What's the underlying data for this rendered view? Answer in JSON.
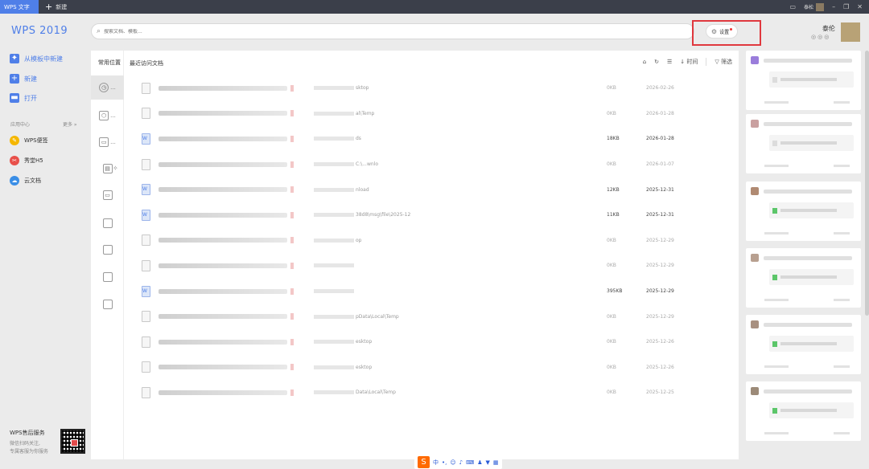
{
  "titlebar": {
    "active_tab": "WPS 文字",
    "new_tab": "新建",
    "user_short": "泰松"
  },
  "sidebar": {
    "logo": "WPS 2019",
    "nav": [
      {
        "label": "从模板中新建",
        "icon": "template-icon"
      },
      {
        "label": "新建",
        "icon": "plus-icon"
      },
      {
        "label": "打开",
        "icon": "folder-open-icon"
      }
    ],
    "apps_label": "应用中心",
    "more": "更多 »",
    "apps": [
      {
        "label": "WPS便签",
        "color": "#f5b700"
      },
      {
        "label": "秀堂H5",
        "color": "#e8504a"
      },
      {
        "label": "云文档",
        "color": "#3a8ee6"
      }
    ],
    "service": {
      "title": "WPS售后服务",
      "line1": "微信扫码关注,",
      "line2": "专属客服为你服务"
    }
  },
  "search": {
    "placeholder": "搜索文档、模板..."
  },
  "settings": {
    "label": "设置"
  },
  "user": {
    "name": "泰伦"
  },
  "places": {
    "title": "常用位置",
    "items": [
      "...",
      "...",
      "..."
    ]
  },
  "main": {
    "title": "最近访问文档",
    "toolbar": {
      "sort": "时间",
      "filter": "筛选"
    },
    "rows": [
      {
        "name": "...ers",
        "path": "sktop",
        "size": "0KB",
        "date": "2026-02-26",
        "dark": false,
        "word": false
      },
      {
        "name": "",
        "path": "al\\Temp",
        "size": "0KB",
        "date": "2026-01-28",
        "dark": false,
        "word": false
      },
      {
        "name": "...docx",
        "path": "ds",
        "size": "18KB",
        "date": "2026-01-28",
        "dark": true,
        "word": true
      },
      {
        "name": "",
        "path": "C:\\...wnlo",
        "size": "0KB",
        "date": "2026-01-07",
        "dark": false,
        "word": false
      },
      {
        "name": "",
        "path": "nload",
        "size": "12KB",
        "date": "2025-12-31",
        "dark": true,
        "word": true
      },
      {
        "name": "",
        "path": "38d8\\msg\\file\\2025-12",
        "size": "11KB",
        "date": "2025-12-31",
        "dark": true,
        "word": true
      },
      {
        "name": "",
        "path": "op",
        "size": "0KB",
        "date": "2025-12-29",
        "dark": false,
        "word": false
      },
      {
        "name": "",
        "path": "",
        "size": "0KB",
        "date": "2025-12-29",
        "dark": false,
        "word": false
      },
      {
        "name": "",
        "path": "",
        "size": "395KB",
        "date": "2025-12-29",
        "dark": true,
        "word": true
      },
      {
        "name": "",
        "path": "pData\\Local\\Temp",
        "size": "0KB",
        "date": "2025-12-29",
        "dark": false,
        "word": false
      },
      {
        "name": "",
        "path": "esktop",
        "size": "0KB",
        "date": "2025-12-26",
        "dark": false,
        "word": false
      },
      {
        "name": "",
        "path": "esktop",
        "size": "0KB",
        "date": "2025-12-26",
        "dark": false,
        "word": false
      },
      {
        "name": "",
        "path": "Data\\Local\\Temp",
        "size": "0KB",
        "date": "2025-12-25",
        "dark": false,
        "word": false
      }
    ]
  },
  "taskbar": {
    "ime": "中"
  }
}
